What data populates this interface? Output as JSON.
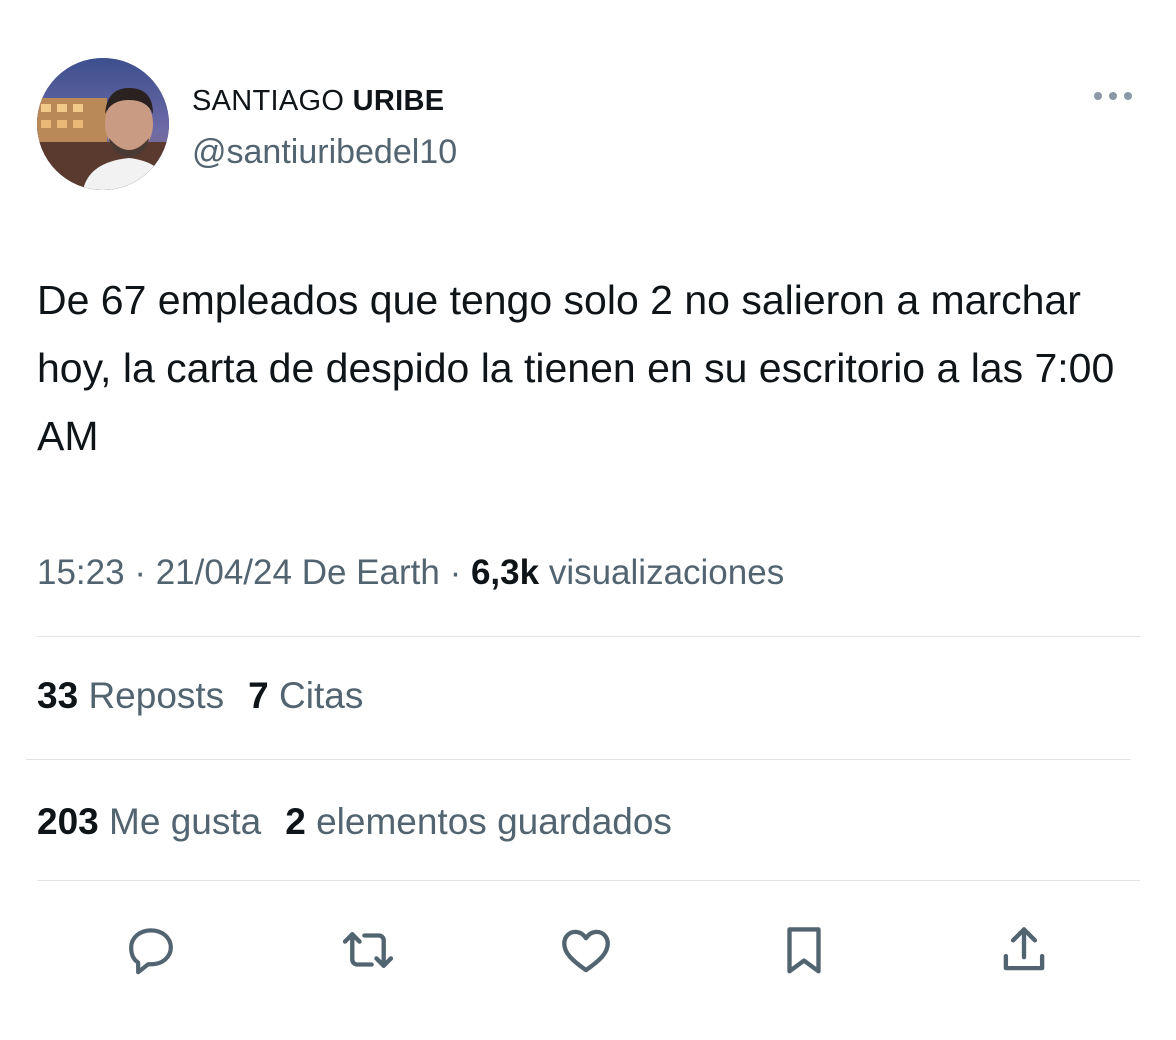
{
  "author": {
    "name_first": "SANTIAGO",
    "name_last": "URIBE",
    "handle": "@santiuribedel10"
  },
  "tweet": {
    "text": "De 67 empleados que tengo solo 2 no salieron a marchar hoy, la carta de despido la tienen en su escritorio a las 7:00 AM"
  },
  "meta": {
    "time": "15:23",
    "separator": "·",
    "date": "21/04/24",
    "source": "De Earth",
    "views_count": "6,3k",
    "views_label": "visualizaciones"
  },
  "stats": {
    "reposts_count": "33",
    "reposts_label": "Reposts",
    "quotes_count": "7",
    "quotes_label": "Citas",
    "likes_count": "203",
    "likes_label": "Me gusta",
    "bookmarks_count": "2",
    "bookmarks_label": "elementos guardados"
  },
  "actions": {
    "icons": [
      "reply-icon",
      "retweet-icon",
      "like-icon",
      "bookmark-icon",
      "share-icon"
    ],
    "icon_color": "#536471"
  },
  "colors": {
    "primary_text": "#0f1419",
    "secondary_text": "#536471",
    "divider": "#dfe3e6"
  }
}
